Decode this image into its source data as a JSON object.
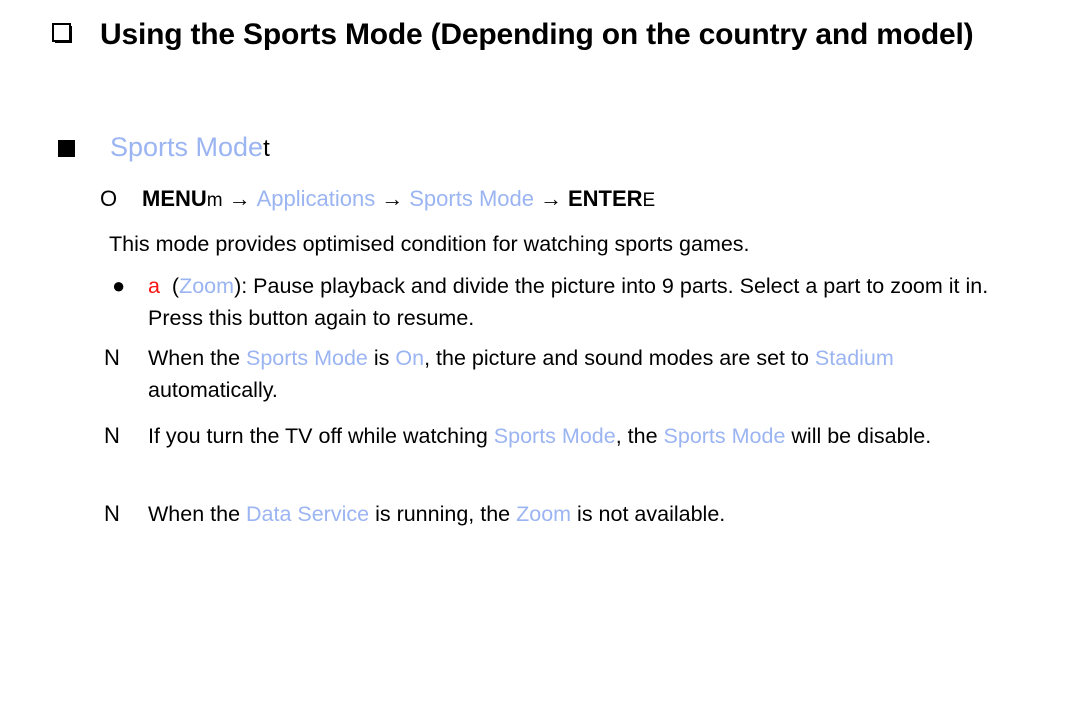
{
  "colors": {
    "accent_blue": "#9BB4F2",
    "accent_red": "#FA1212",
    "text": "#000000",
    "background": "#FFFFFF"
  },
  "title": {
    "bullet": "hollow-square-shadow",
    "text": "Using the Sports Mode (Depending on the country and model)"
  },
  "subheading": {
    "bullet": "filled-square",
    "label": "Sports Mode",
    "key_glyph": "t"
  },
  "menu_path": {
    "marker": "O",
    "segment1": "MENU",
    "segment1_glyph": "m",
    "arrow": "→",
    "segment2": "Applications",
    "segment3": "Sports Mode",
    "segment4": "ENTER",
    "segment4_glyph": "E"
  },
  "description": "This mode provides optimised condition for watching sports games.",
  "notes": [
    {
      "marker": "●",
      "key": "a",
      "open_paren": "(",
      "key_name": "Zoom",
      "close_paren": "): ",
      "line1_rest": "Pause playback and divide the picture into 9 parts. Select a part",
      "line2": "to zoom it in. Press this button again to resume."
    },
    {
      "marker": "N",
      "line1_a": "When the ",
      "line1_blue1": "Sports Mode",
      "line1_b": " is ",
      "line1_blue2": "On",
      "line1_c": ", the picture and sound modes are set to",
      "line2_blue": "Stadium",
      "line2_rest": " automatically."
    },
    {
      "marker": "N",
      "line1_a": "If you turn the TV off while watching ",
      "line1_blue1": "Sports Mode",
      "line1_b": ", the ",
      "line1_blue2": "Sports Mode",
      "line1_c": " will be",
      "line2": "disable."
    },
    {
      "marker": "N",
      "line1_a": "When the ",
      "line1_blue1": "Data Service",
      "line1_b": " is running, the ",
      "line1_blue2": "Zoom",
      "line1_c": " is not available."
    }
  ]
}
